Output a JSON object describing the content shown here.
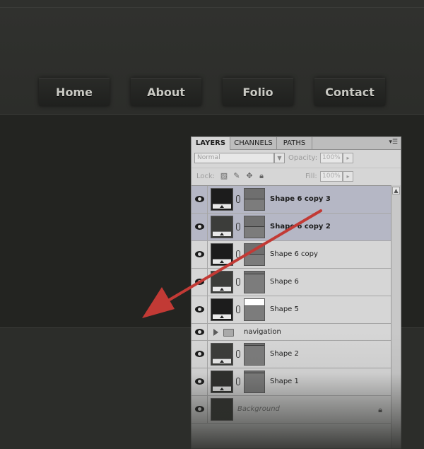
{
  "nav": {
    "home": "Home",
    "about": "About",
    "folio": "Folio",
    "contact": "Contact"
  },
  "panel": {
    "tabs": {
      "layers": "LAYERS",
      "channels": "CHANNELS",
      "paths": "PATHS"
    },
    "blend_mode": "Normal",
    "opacity_label": "Opacity:",
    "opacity_value": "100%",
    "lock_label": "Lock:",
    "fill_label": "Fill:",
    "fill_value": "100%",
    "layers": [
      {
        "name": "Shape 6 copy 3",
        "selected": true
      },
      {
        "name": "Shape 6 copy 2",
        "selected": true
      },
      {
        "name": "Shape 6 copy",
        "selected": false
      },
      {
        "name": "Shape 6",
        "selected": false
      },
      {
        "name": "Shape 5",
        "selected": false
      },
      {
        "name": "navigation",
        "type": "group"
      },
      {
        "name": "Shape 2",
        "selected": false
      },
      {
        "name": "Shape 1",
        "selected": false
      },
      {
        "name": "Background",
        "type": "background",
        "locked": true
      }
    ]
  },
  "colors": {
    "arrow": "#c23a35",
    "selection": "#b5b7c5",
    "page_bg": "#2b2c29"
  },
  "icons": [
    "eye-icon",
    "chain-link-icon",
    "folder-icon",
    "lock-icon",
    "move-icon",
    "brush-icon",
    "panel-menu-icon"
  ]
}
